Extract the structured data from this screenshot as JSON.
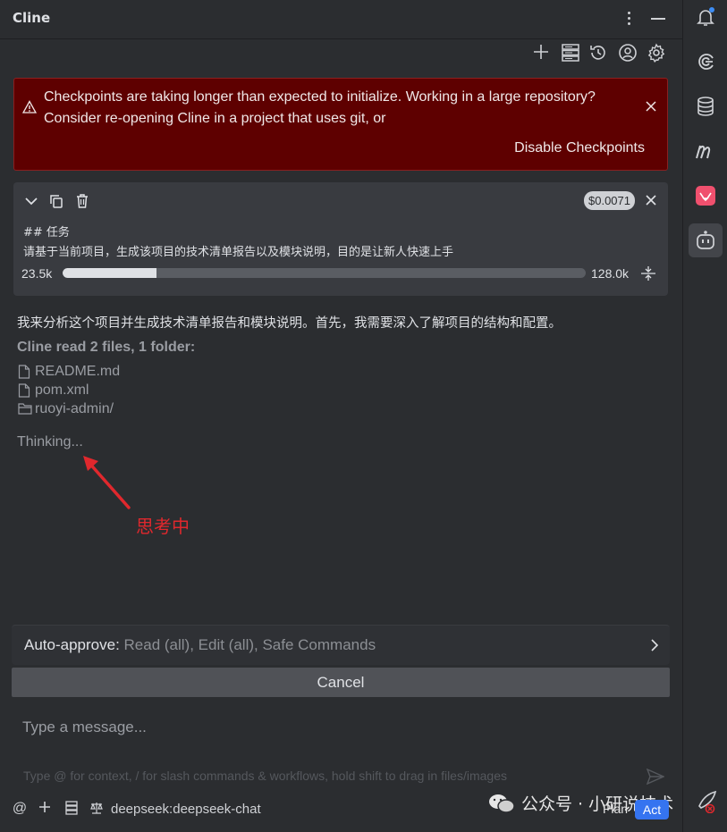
{
  "header": {
    "title": "Cline"
  },
  "banner": {
    "message": "Checkpoints are taking longer than expected to initialize. Working in a large repository? Consider re-opening Cline in a project that uses git, or",
    "action": "Disable Checkpoints"
  },
  "task": {
    "cost": "$0.0071",
    "heading": "## 任务",
    "text": "请基于当前项目，生成该项目的技术清单报告以及模块说明，目的是让新人快速上手",
    "tokens_used": "23.5k",
    "tokens_max": "128.0k",
    "context_fraction": 0.18
  },
  "chat": {
    "reply": "我来分析这个项目并生成技术清单报告和模块说明。首先，我需要深入了解项目的结构和配置。",
    "read_heading": "Cline read 2 files, 1 folder:",
    "files": [
      {
        "name": "README.md",
        "icon": "file-icon"
      },
      {
        "name": "pom.xml",
        "icon": "file-icon"
      },
      {
        "name": "ruoyi-admin/",
        "icon": "folder-icon"
      }
    ],
    "thinking": "Thinking...",
    "annotation": "思考中"
  },
  "auto_approve": {
    "label": "Auto-approve:",
    "value": " Read (all), Edit (all), Safe Commands"
  },
  "cancel_label": "Cancel",
  "input": {
    "placeholder": "Type a message...",
    "hint": "Type @ for context, / for slash commands & workflows, hold shift to drag in files/images"
  },
  "bottom": {
    "model": "deepseek:deepseek-chat",
    "plan_label": "Plan",
    "act_label": "Act",
    "watermark": "公众号 · 小研说技术"
  },
  "colors": {
    "banner_bg": "#5e0000",
    "accent": "#3574f0",
    "annotation": "#e0282d"
  }
}
